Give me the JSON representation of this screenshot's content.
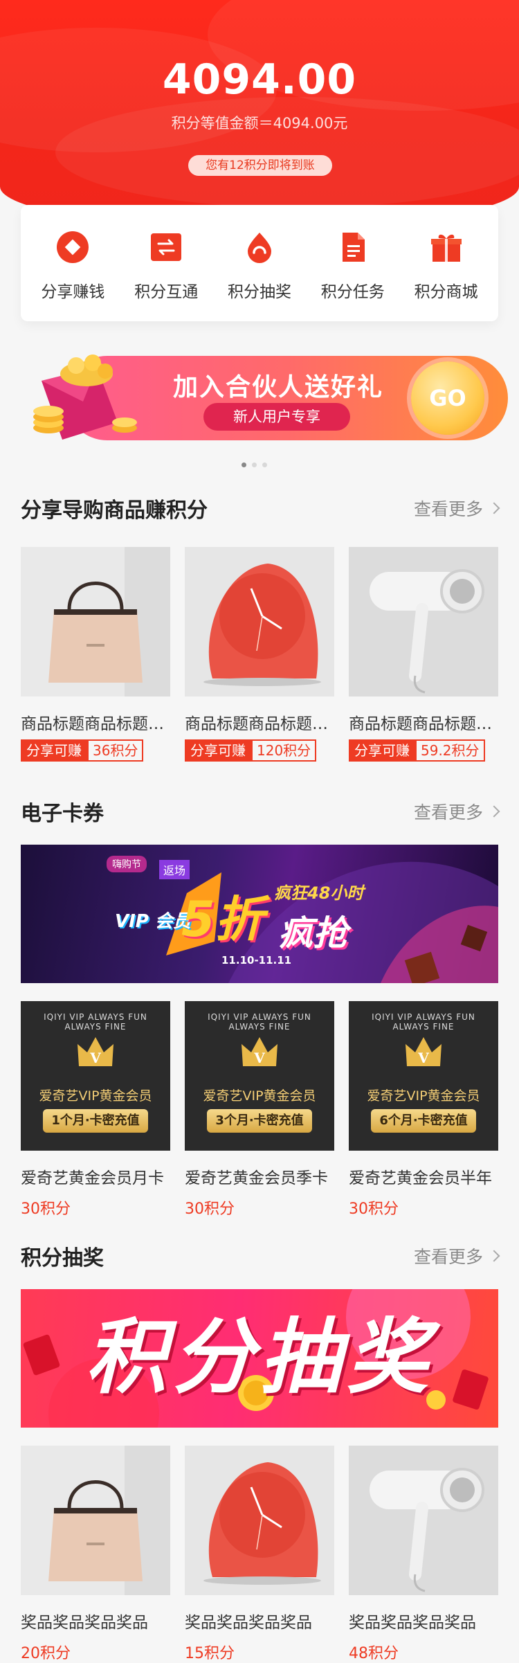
{
  "header": {
    "balance": "4094.00",
    "equivalent": "积分等值金额＝4094.00元",
    "notice": "您有12积分即将到账"
  },
  "nav": [
    {
      "label": "分享赚钱",
      "icon": "share-diamond-icon"
    },
    {
      "label": "积分互通",
      "icon": "exchange-arrows-icon"
    },
    {
      "label": "积分抽奖",
      "icon": "lottery-drop-icon"
    },
    {
      "label": "积分任务",
      "icon": "task-document-icon"
    },
    {
      "label": "积分商城",
      "icon": "gift-box-icon"
    }
  ],
  "banner": {
    "title": "加入合伙人送好礼",
    "subtitle": "新人用户专享",
    "go": "GO"
  },
  "share_section": {
    "title": "分享导购商品赚积分",
    "more": "查看更多",
    "items": [
      {
        "title": "商品标题商品标题商品标题",
        "tag": "分享可赚",
        "points": "36积分",
        "image": "handbag"
      },
      {
        "title": "商品标题商品标题商品标题",
        "tag": "分享可赚",
        "points": "120积分",
        "image": "clock"
      },
      {
        "title": "商品标题商品标题商品标题",
        "tag": "分享可赚",
        "points": "59.2积分",
        "image": "hairdryer"
      }
    ]
  },
  "coupon_section": {
    "title": "电子卡券",
    "more": "查看更多",
    "banner": {
      "headline": "疯狂48小时",
      "vip_text": "VIP 会员",
      "big": "5折",
      "text": "疯抢",
      "dates": "11.10-11.11",
      "corner_badge": "嗨购节",
      "corner_tag": "返场"
    },
    "items": [
      {
        "title": "爱奇艺黄金会员月卡",
        "points": "30积分",
        "card_name": "爱奇艺VIP黄金会员",
        "plate": "1个月·卡密充值"
      },
      {
        "title": "爱奇艺黄金会员季卡",
        "points": "30积分",
        "card_name": "爱奇艺VIP黄金会员",
        "plate": "3个月·卡密充值"
      },
      {
        "title": "爱奇艺黄金会员半年",
        "points": "30积分",
        "card_name": "爱奇艺VIP黄金会员",
        "plate": "6个月·卡密充值"
      }
    ],
    "card_arc": "IQIYI VIP ALWAYS FUN ALWAYS FINE"
  },
  "lottery_section": {
    "title": "积分抽奖",
    "more": "查看更多",
    "banner_text": "积分抽奖",
    "items": [
      {
        "title": "奖品奖品奖品奖品",
        "points": "20积分",
        "image": "handbag"
      },
      {
        "title": "奖品奖品奖品奖品",
        "points": "15积分",
        "image": "clock"
      },
      {
        "title": "奖品奖品奖品奖品",
        "points": "48积分",
        "image": "hairdryer"
      }
    ]
  },
  "colors": {
    "brand_red": "#ee3b23",
    "header_red": "#f4261a"
  }
}
